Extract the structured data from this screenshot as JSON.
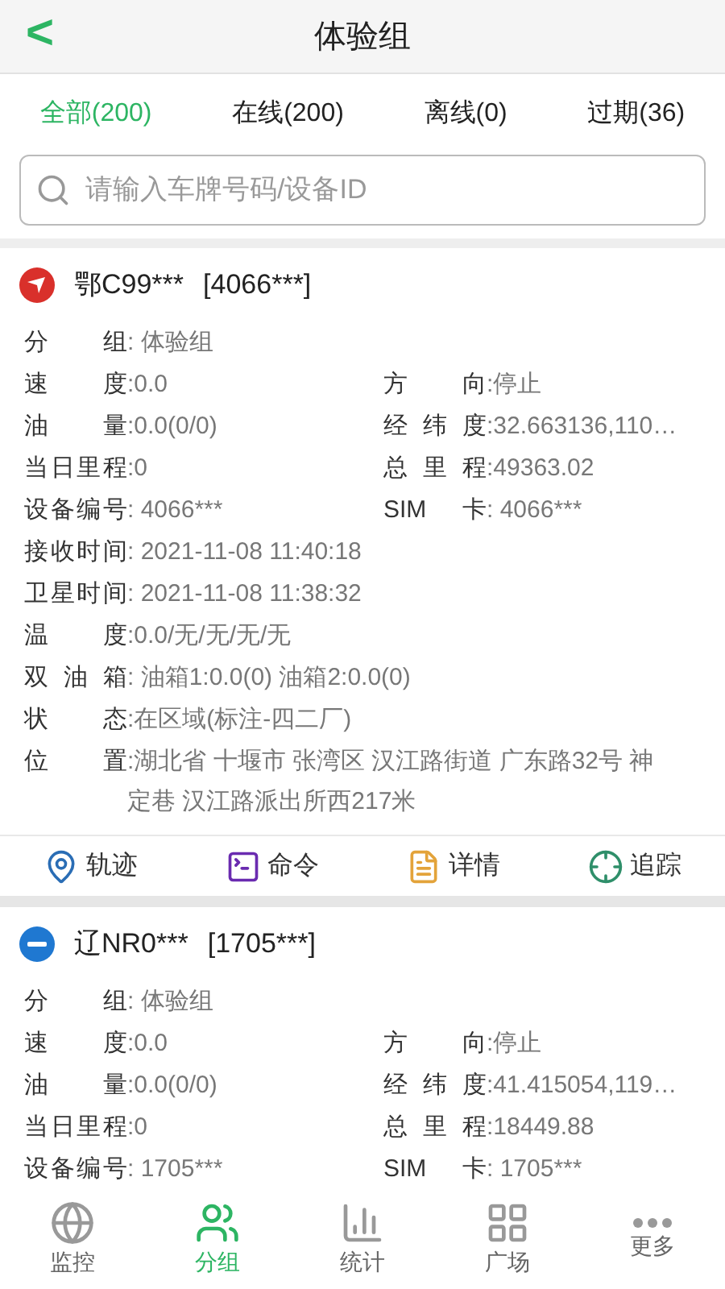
{
  "header": {
    "back": "<",
    "title": "体验组"
  },
  "tabs": [
    {
      "label": "全部(200)",
      "selected": true
    },
    {
      "label": "在线(200)",
      "selected": false
    },
    {
      "label": "离线(0)",
      "selected": false
    },
    {
      "label": "过期(36)",
      "selected": false
    }
  ],
  "search": {
    "placeholder": "请输入车牌号码/设备ID"
  },
  "vehicles": [
    {
      "kind": "moving",
      "plate": "鄂C99***",
      "id": "[4066***]",
      "rows": [
        [
          {
            "label": "分组",
            "value": ": 体验组"
          }
        ],
        [
          {
            "label": "速度",
            "value": ":0.0"
          },
          {
            "label": "方向",
            "value": ":停止"
          }
        ],
        [
          {
            "label": "油量",
            "value": ":0.0(0/0)"
          },
          {
            "label": "经纬度",
            "value": ":32.663136,110…"
          }
        ],
        [
          {
            "label": "当日里程",
            "value": ":0"
          },
          {
            "label": "总里程",
            "value": ":49363.02"
          }
        ],
        [
          {
            "label": "设备编号",
            "value": ": 4066***"
          },
          {
            "label": "SIM卡",
            "value": ": 4066***"
          }
        ],
        [
          {
            "label": "接收时间",
            "value": ": 2021-11-08 11:40:18"
          }
        ],
        [
          {
            "label": "卫星时间",
            "value": ": 2021-11-08 11:38:32"
          }
        ],
        [
          {
            "label": "温度",
            "value": ":0.0/无/无/无/无"
          }
        ],
        [
          {
            "label": "双油箱",
            "value": ": 油箱1:0.0(0) 油箱2:0.0(0)"
          }
        ],
        [
          {
            "label": "状态",
            "value": ":在区域(标注-四二厂)"
          }
        ],
        [
          {
            "label": "位置",
            "value": ":湖北省 十堰市 张湾区 汉江路街道 广东路32号 神定巷 汉江路派出所西217米"
          }
        ]
      ],
      "actions": [
        {
          "kind": "track",
          "label": "轨迹"
        },
        {
          "kind": "command",
          "label": "命令"
        },
        {
          "kind": "detail",
          "label": "详情"
        },
        {
          "kind": "follow",
          "label": "追踪"
        }
      ]
    },
    {
      "kind": "offline",
      "plate": "辽NR0***",
      "id": "[1705***]",
      "rows": [
        [
          {
            "label": "分组",
            "value": ": 体验组"
          }
        ],
        [
          {
            "label": "速度",
            "value": ":0.0"
          },
          {
            "label": "方向",
            "value": ":停止"
          }
        ],
        [
          {
            "label": "油量",
            "value": ":0.0(0/0)"
          },
          {
            "label": "经纬度",
            "value": ":41.415054,119…"
          }
        ],
        [
          {
            "label": "当日里程",
            "value": ":0"
          },
          {
            "label": "总里程",
            "value": ":18449.88"
          }
        ],
        [
          {
            "label": "设备编号",
            "value": ": 1705***"
          },
          {
            "label": "SIM卡",
            "value": ": 1705***"
          }
        ]
      ]
    }
  ],
  "nav": [
    {
      "kind": "monitor",
      "label": "监控",
      "selected": false
    },
    {
      "kind": "group",
      "label": "分组",
      "selected": true
    },
    {
      "kind": "stats",
      "label": "统计",
      "selected": false
    },
    {
      "kind": "square",
      "label": "广场",
      "selected": false
    },
    {
      "kind": "more",
      "label": "更多",
      "selected": false
    }
  ]
}
